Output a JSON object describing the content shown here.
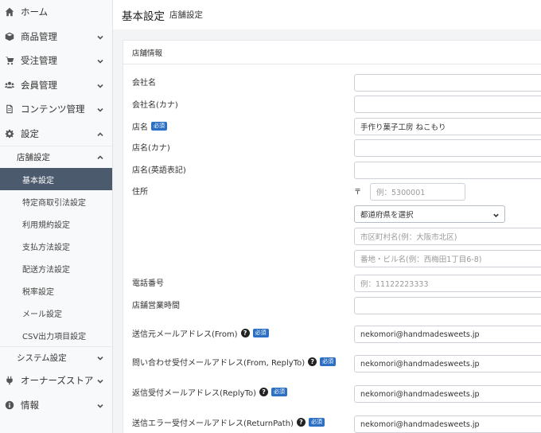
{
  "sidebar": {
    "items": [
      {
        "label": "ホーム",
        "icon": "home-icon"
      },
      {
        "label": "商品管理",
        "icon": "cube-icon"
      },
      {
        "label": "受注管理",
        "icon": "cart-icon"
      },
      {
        "label": "会員管理",
        "icon": "users-icon"
      },
      {
        "label": "コンテンツ管理",
        "icon": "file-icon"
      },
      {
        "label": "設定",
        "icon": "gear-icon"
      }
    ],
    "settings_sub_head": "店舗設定",
    "settings_sub_items": [
      "基本設定",
      "特定商取引法設定",
      "利用規約設定",
      "支払方法設定",
      "配送方法設定",
      "税率設定",
      "メール設定",
      "CSV出力項目設定"
    ],
    "system_head": "システム設定",
    "bottom_items": [
      {
        "label": "オーナーズストア",
        "icon": "plug-icon"
      },
      {
        "label": "情報",
        "icon": "info-icon"
      }
    ]
  },
  "header": {
    "title": "基本設定",
    "subtitle": "店舗設定"
  },
  "card": {
    "title": "店舗情報"
  },
  "required_badge": "必須",
  "form": {
    "company_name": {
      "label": "会社名",
      "value": ""
    },
    "company_kana": {
      "label": "会社名(カナ)",
      "value": ""
    },
    "shop_name": {
      "label": "店名",
      "value": "手作り菓子工房 ねこもり"
    },
    "shop_kana": {
      "label": "店名(カナ)",
      "value": ""
    },
    "shop_name_en": {
      "label": "店名(英語表記)",
      "value": ""
    },
    "address": {
      "label": "住所",
      "zip_mark": "〒",
      "zip_placeholder": "例：5300001",
      "pref_selected": "都道府県を選択",
      "city_placeholder": "市区町村名(例：大阪市北区)",
      "addr_placeholder": "番地・ビル名(例：西梅田1丁目6-8)"
    },
    "phone": {
      "label": "電話番号",
      "placeholder": "例：11122223333"
    },
    "hours": {
      "label": "店舗営業時間",
      "value": ""
    },
    "email_from": {
      "label": "送信元メールアドレス(From)",
      "value": "nekomori@handmadesweets.jp"
    },
    "email_contact": {
      "label": "問い合わせ受付メールアドレス(From, ReplyTo)",
      "value": "nekomori@handmadesweets.jp"
    },
    "email_reply": {
      "label": "返信受付メールアドレス(ReplyTo)",
      "value": "nekomori@handmadesweets.jp"
    },
    "email_error": {
      "label": "送信エラー受付メールアドレス(ReturnPath)",
      "value": "nekomori@handmadesweets.jp"
    }
  },
  "colors": {
    "active_nav": "#4b5a6c",
    "required_badge": "#2d6fc3"
  }
}
